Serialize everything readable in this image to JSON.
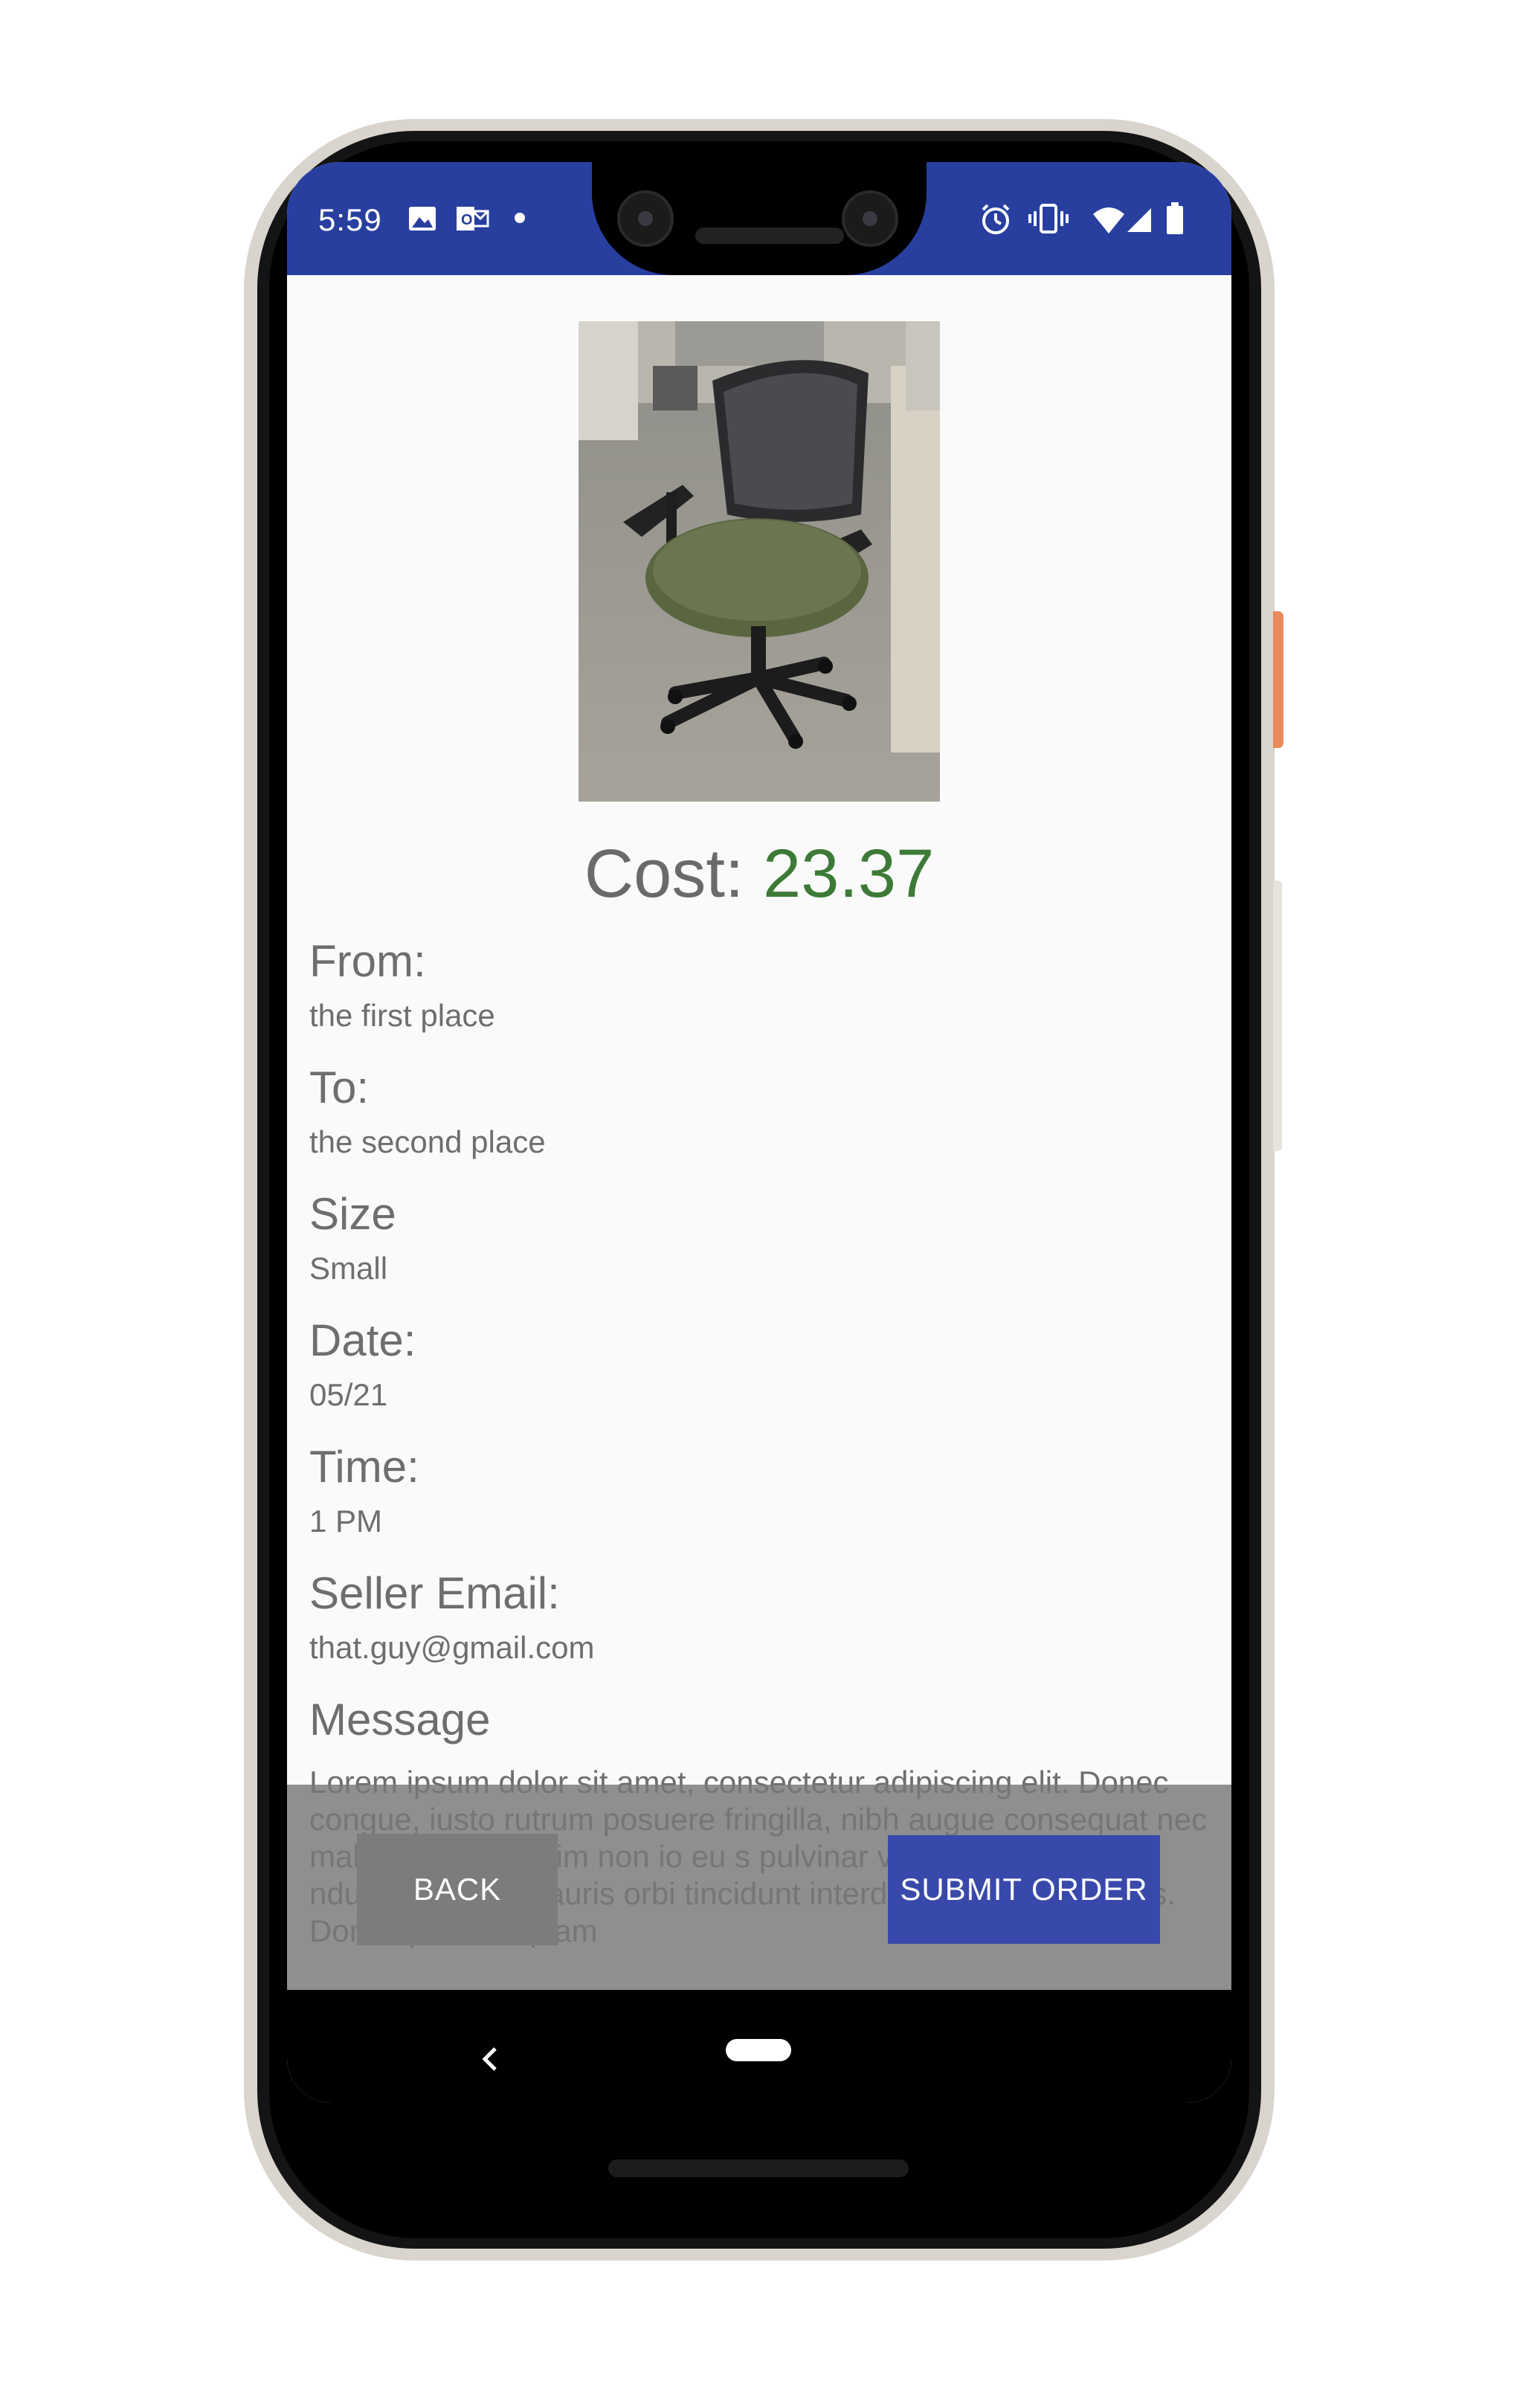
{
  "status_bar": {
    "time": "5:59",
    "left_icons": [
      "image-icon",
      "outlook-icon",
      "dot-icon"
    ],
    "right_icons": [
      "alarm-icon",
      "vibrate-icon",
      "wifi-icon",
      "signal-icon",
      "battery-icon"
    ],
    "color": "#283fa0"
  },
  "product": {
    "image_icon": "office-chair-photo",
    "cost_label": "Cost:",
    "cost_value": "23.37",
    "cost_color": "#3d7a37"
  },
  "details": {
    "from_label": "From:",
    "from_value": "the first place",
    "to_label": "To:",
    "to_value": "the second place",
    "size_label": "Size",
    "size_value": "Small",
    "date_label": "Date:",
    "date_value": "05/21",
    "time_label": "Time:",
    "time_value": "1 PM",
    "seller_email_label": "Seller Email:",
    "seller_email_value": "that.guy@gmail.com",
    "message_label": "Message",
    "message_value": "Lorem ipsum dolor sit amet, consectetur adipiscing elit. Donec congue, iusto rutrum posuere fringilla, nibh augue consequat nec malesuada dui enim non io eu s pulvinar vel sed erat. tor ma ndum tincidunt mauris orbi tincidunt interdum quam nec luctus. Donec porta aliquam"
  },
  "actions": {
    "back_label": "BACK",
    "submit_label": "SUBMIT ORDER",
    "submit_color": "#3949ab"
  },
  "nav_bar": {
    "back_icon": "chevron-left-icon",
    "home_icon": "home-pill-icon"
  }
}
